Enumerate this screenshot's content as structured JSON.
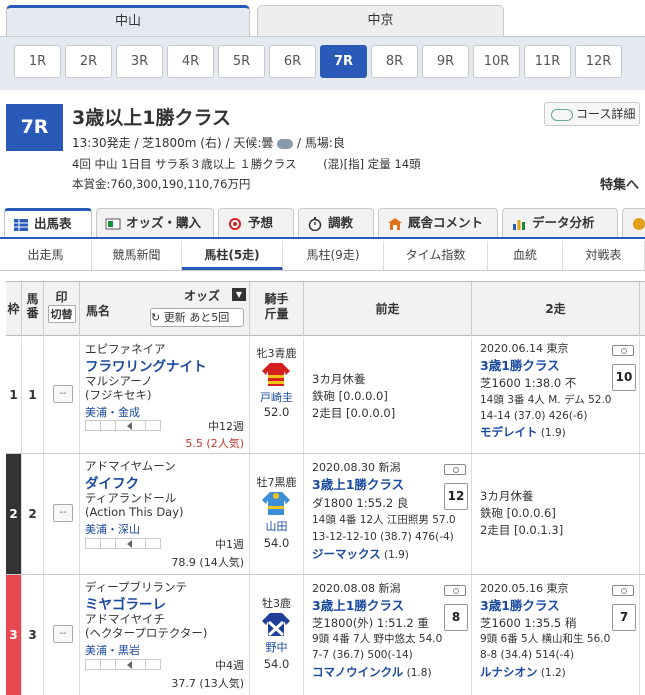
{
  "venue_tabs": [
    {
      "label": "中山",
      "active": true
    },
    {
      "label": "中京",
      "active": false
    }
  ],
  "races": [
    "1R",
    "2R",
    "3R",
    "4R",
    "5R",
    "6R",
    "7R",
    "8R",
    "9R",
    "10R",
    "11R",
    "12R"
  ],
  "active_race": "7R",
  "header": {
    "race_no": "7R",
    "title": "3歳以上1勝クラス",
    "meta_before": "13:30発走 / 芝1800m (右) / 天候:曇",
    "meta_after": " / 馬場:良",
    "weather_icon": "cloud-icon",
    "conditions": "4回 中山 1日目 サラ系３歳以上 １勝クラス　　 (混)[指] 定量 14頭",
    "prize": "本賞金:760,300,190,110,76万円",
    "course_button": "コース詳細",
    "feature_link": "特集へ"
  },
  "main_tabs": [
    {
      "label": "出馬表",
      "icon": "table-icon",
      "active": true
    },
    {
      "label": "オッズ・購入",
      "icon": "odds-icon",
      "active": false
    },
    {
      "label": "予想",
      "icon": "target-icon",
      "active": false
    },
    {
      "label": "調教",
      "icon": "stopwatch-icon",
      "active": false
    },
    {
      "label": "厩舎コメント",
      "icon": "stable-icon",
      "active": false
    },
    {
      "label": "データ分析",
      "icon": "chart-icon",
      "active": false
    }
  ],
  "sub_tabs": [
    {
      "label": "出走馬",
      "active": false
    },
    {
      "label": "競馬新聞",
      "active": false
    },
    {
      "label": "馬柱(5走)",
      "active": true
    },
    {
      "label": "馬柱(9走)",
      "active": false
    },
    {
      "label": "タイム指数",
      "active": false
    },
    {
      "label": "血統",
      "active": false
    },
    {
      "label": "対戦表",
      "active": false
    }
  ],
  "table_headers": {
    "waku": "枠",
    "num": "馬番",
    "mark": "印",
    "mark_button": "切替",
    "horse": "馬名",
    "odds": "オッズ",
    "refresh": "更新 あと5回",
    "jockey": "騎手",
    "weight": "斤量",
    "prev1": "前走",
    "prev2": "2走"
  },
  "rows": [
    {
      "waku": "1",
      "num": "1",
      "waku_color": "#ffffff",
      "waku_text": "#333333",
      "mark": "--",
      "sire": "エピファネイア",
      "horse": "フラワリングナイト",
      "dam_lines": [
        "マルシアーノ",
        "(フジキセキ)"
      ],
      "trainer": "美浦・金成",
      "interval": "中12週",
      "odds": "5.5 (2人気)",
      "odds_hot": true,
      "sex_age": "牝3青鹿",
      "jockey": "戸崎圭",
      "weight": "52.0",
      "silk_color": "#d62020",
      "silk_accent": "#f0c419",
      "prev1": {
        "type": "rest",
        "lines": [
          "3カ月休養",
          "鉄砲 [0.0.0.0]",
          "2走目 [0.0.0.0]"
        ]
      },
      "prev2": {
        "type": "race",
        "date": "2020.06.14 東京",
        "race": "3歳1勝クラス",
        "detail": "芝1600 1:38.0 不",
        "line3": "14頭 3番 4人 M. デム 52.0",
        "line4": "14-14 (37.0) 426(-6)",
        "winner": "モデレイト",
        "winner_note": " (1.9)",
        "place": "10"
      }
    },
    {
      "waku": "2",
      "num": "2",
      "waku_color": "#333333",
      "waku_text": "#ffffff",
      "mark": "--",
      "sire": "アドマイヤムーン",
      "horse": "ダイフク",
      "dam_lines": [
        "ティアランドール",
        "(Action This Day)"
      ],
      "trainer": "美浦・深山",
      "interval": "中1週",
      "odds": "78.9 (14人気)",
      "odds_hot": false,
      "sex_age": "牡7黒鹿",
      "jockey": "山田",
      "weight": "54.0",
      "silk_color": "#3d8fd8",
      "silk_accent": "#f0c419",
      "prev1": {
        "type": "race",
        "date": "2020.08.30 新潟",
        "race": "3歳上1勝クラス",
        "detail": "ダ1800 1:55.2 良",
        "line3": "14頭 4番 12人 江田照男 57.0",
        "line4": "13-12-12-10 (38.7) 476(-4)",
        "winner": "ジーマックス",
        "winner_note": " (1.9)",
        "place": "12"
      },
      "prev2": {
        "type": "rest",
        "lines": [
          "3カ月休養",
          "鉄砲 [0.0.0.6]",
          "2走目 [0.0.1.3]"
        ]
      }
    },
    {
      "waku": "3",
      "num": "3",
      "waku_color": "#e8484f",
      "waku_text": "#ffffff",
      "mark": "--",
      "sire": "ディープブリランテ",
      "horse": "ミヤゴラーレ",
      "dam_lines": [
        "アドマイヤイチ",
        "(ヘクタープロテクター)"
      ],
      "trainer": "美浦・黒岩",
      "interval": "中4週",
      "odds": "37.7 (13人気)",
      "odds_hot": false,
      "sex_age": "牡3鹿",
      "jockey": "野中",
      "weight": "54.0",
      "silk_color": "#1f3f9a",
      "silk_accent": "#ffffff",
      "prev1": {
        "type": "race",
        "date": "2020.08.08 新潟",
        "race": "3歳上1勝クラス",
        "detail": "芝1800(外) 1:51.2 重",
        "line3": "9頭 4番 7人 野中悠太 54.0",
        "line4": "7-7 (36.7) 500(-14)",
        "winner": "コマノウインクル",
        "winner_note": " (1.8)",
        "place": "8"
      },
      "prev2": {
        "type": "race",
        "date": "2020.05.16 東京",
        "race": "3歳1勝クラス",
        "detail": "芝1600 1:35.5 稍",
        "line3": "9頭 6番 5人 横山和生 56.0",
        "line4": "8-8 (34.4) 514(-4)",
        "winner": "ルナシオン",
        "winner_note": " (1.2)",
        "place": "7"
      }
    }
  ]
}
